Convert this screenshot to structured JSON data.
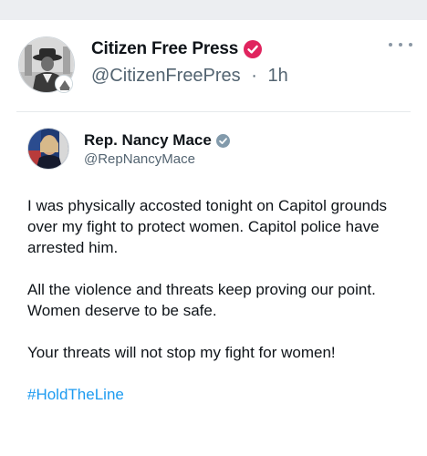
{
  "post": {
    "author_name": "Citizen Free Press",
    "author_handle": "@CitizenFreePres",
    "separator": "·",
    "timestamp": "1h"
  },
  "quoted": {
    "author_name": "Rep. Nancy Mace",
    "author_handle": "@RepNancyMace",
    "paragraph_1": "I was physically accosted tonight on Capitol grounds over my fight to protect women. Capitol police have arrested him.",
    "paragraph_2": "All the violence and threats keep proving our point. Women deserve to be safe.",
    "paragraph_3": "Your threats will not stop my fight for women!",
    "hashtag": "#HoldTheLine"
  },
  "icons": {
    "verified_main": "red-verified-check-icon",
    "verified_quoted": "gray-verified-check-icon",
    "more": "more-dots-icon"
  },
  "colors": {
    "verified_red": "#e0245e",
    "verified_gray": "#829aab",
    "hashtag_blue": "#1d9bf0",
    "secondary_text": "#536471"
  }
}
